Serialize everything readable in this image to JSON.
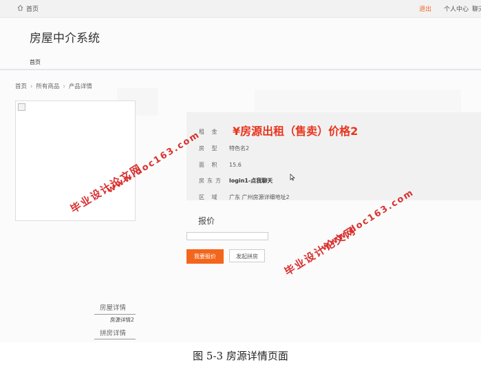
{
  "topbar": {
    "home_label": "首页",
    "logout_label": "退出",
    "user_center_label": "个人中心",
    "chat_label": "聊天"
  },
  "header": {
    "site_title": "房屋中介系统",
    "nav_home": "首页"
  },
  "breadcrumb": {
    "items": [
      "首页",
      "所有商品",
      "产品详情"
    ]
  },
  "product": {
    "price_title": "¥房源出租（售卖）价格2",
    "fields": [
      {
        "label": "租  金",
        "value": ""
      },
      {
        "label": "房  型",
        "value": "特色名2"
      },
      {
        "label": "面  积",
        "value": "15.6"
      },
      {
        "label": "房东方",
        "value": "login1-点我聊天"
      },
      {
        "label": "区  域",
        "value": "广东 广州房源详细地址2"
      }
    ]
  },
  "quote": {
    "label": "报价",
    "input_value": "",
    "submit_label": "我要报价",
    "group_label": "发起拼房"
  },
  "tabs": {
    "detail": "房屋详情",
    "detail_sub": "房源详情2",
    "group": "拼房详情"
  },
  "watermark": {
    "line_cn": "毕业设计论文网",
    "line_url": "www.doc163.com"
  },
  "caption": "图 5-3 房源详情页面",
  "colors": {
    "accent": "#f3661c",
    "price": "#e8341c",
    "watermark": "#d9302e"
  }
}
